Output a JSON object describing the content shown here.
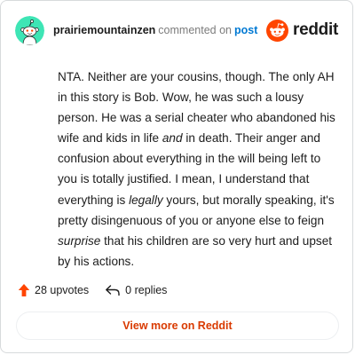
{
  "header": {
    "username": "prairiemountainzen",
    "action": "commented on",
    "post_link": "post",
    "brand": "reddit",
    "avatar_icon": "snoo-avatar-icon",
    "brand_icon": "reddit-logo-icon",
    "colors": {
      "avatar_bg": "#3ee5b5",
      "brand": "#ff4500",
      "link": "#0079d3"
    }
  },
  "comment": {
    "p1": "NTA. Neither are your cousins, though. The only AH in this story is Bob. Wow, he was such a lousy person. He was a serial cheater who abandoned his wife and kids in life ",
    "em1": "and",
    "p2": " in death. Their anger and confusion about everything in the will being left to you is totally justified. I mean, I understand that everything is ",
    "em2": "legally",
    "p3": " yours, but morally speaking, it's pretty disingenuous of you or anyone else to feign ",
    "em3": "surprise",
    "p4": " that his children are so very hurt and upset by his actions."
  },
  "meta": {
    "upvotes": "28 upvotes",
    "replies": "0 replies",
    "upvote_icon": "upvote-arrow-icon",
    "reply_icon": "reply-arrow-icon"
  },
  "footer": {
    "button_label": "View more on Reddit",
    "color": "#d93a00"
  }
}
